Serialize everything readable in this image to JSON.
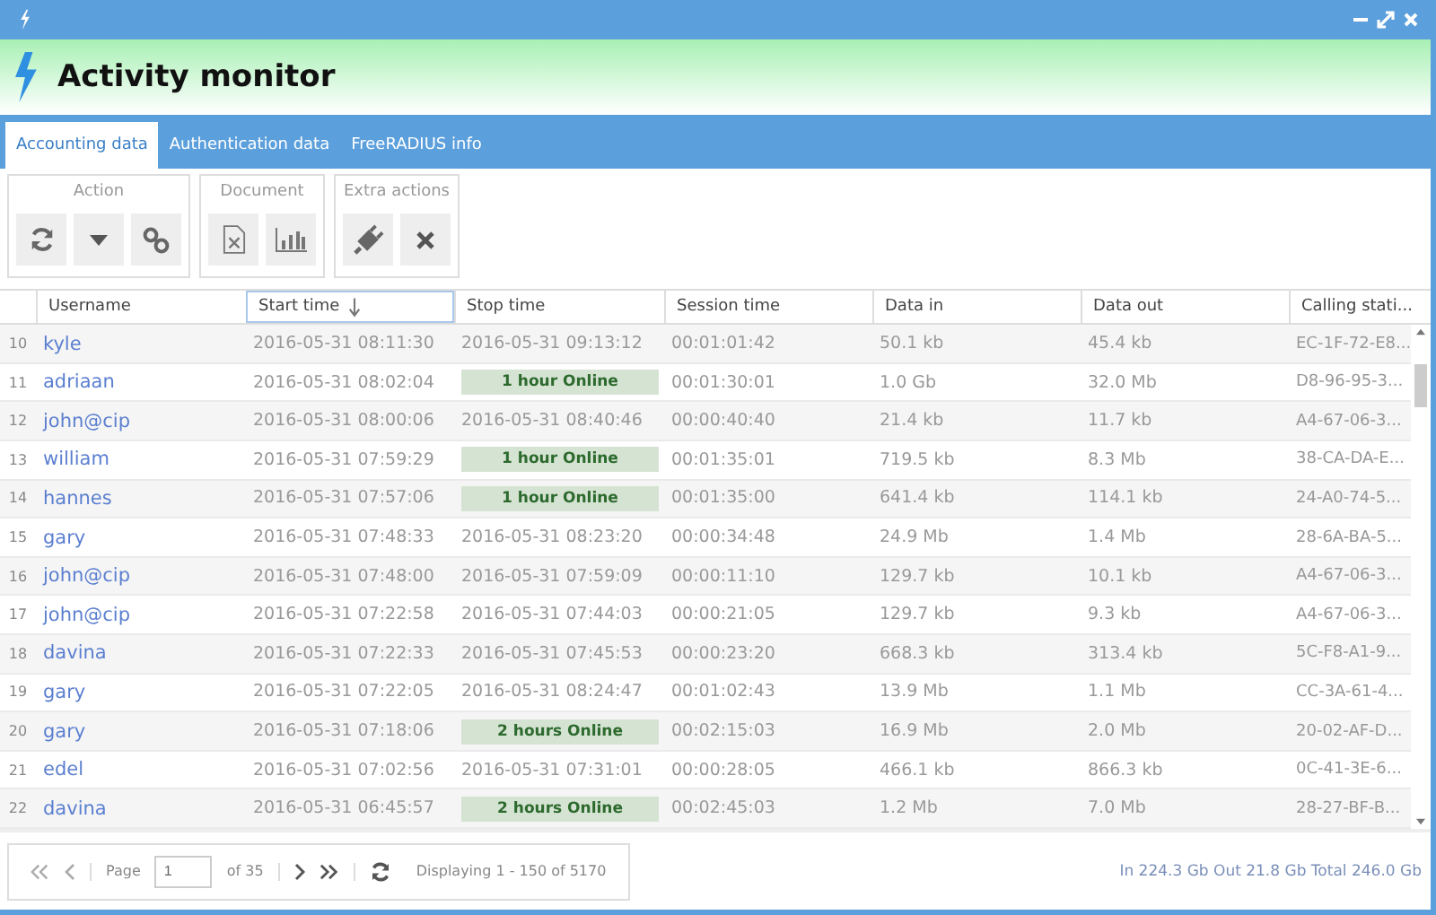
{
  "window": {
    "title": "Activity monitor"
  },
  "tabs": [
    {
      "label": "Accounting data",
      "selected": true
    },
    {
      "label": "Authentication data",
      "selected": false
    },
    {
      "label": "FreeRADIUS info",
      "selected": false
    }
  ],
  "toolbar_groups": [
    {
      "title": "Action",
      "buttons": [
        {
          "kind": "refresh"
        },
        {
          "kind": "dropdown"
        },
        {
          "kind": "link"
        }
      ]
    },
    {
      "title": "Document",
      "buttons": [
        {
          "kind": "excel"
        },
        {
          "kind": "chart"
        }
      ]
    },
    {
      "title": "Extra actions",
      "buttons": [
        {
          "kind": "plug"
        },
        {
          "kind": "delete"
        }
      ]
    }
  ],
  "table": {
    "columns": [
      {
        "label": "Username",
        "sorted": false
      },
      {
        "label": "Start time",
        "sorted": true
      },
      {
        "label": "Stop time",
        "sorted": false
      },
      {
        "label": "Session time",
        "sorted": false
      },
      {
        "label": "Data in",
        "sorted": false
      },
      {
        "label": "Data out",
        "sorted": false
      },
      {
        "label": "Calling stati...",
        "sorted": false
      }
    ],
    "rows": [
      {
        "number": "10",
        "username": "kyle",
        "start": "2016-05-31 08:11:30",
        "stop": {
          "kind": "time",
          "text": "2016-05-31 09:13:12"
        },
        "session": "00:01:01:42",
        "data_in": "50.1 kb",
        "data_out": "45.4 kb",
        "calling": "EC-1F-72-E8..."
      },
      {
        "number": "11",
        "username": "adriaan",
        "start": "2016-05-31 08:02:04",
        "stop": {
          "kind": "online",
          "text": "1 hour Online"
        },
        "session": "00:01:30:01",
        "data_in": "1.0 Gb",
        "data_out": "32.0 Mb",
        "calling": "D8-96-95-3..."
      },
      {
        "number": "12",
        "username": "john@cip",
        "start": "2016-05-31 08:00:06",
        "stop": {
          "kind": "time",
          "text": "2016-05-31 08:40:46"
        },
        "session": "00:00:40:40",
        "data_in": "21.4 kb",
        "data_out": "11.7 kb",
        "calling": "A4-67-06-3..."
      },
      {
        "number": "13",
        "username": "william",
        "start": "2016-05-31 07:59:29",
        "stop": {
          "kind": "online",
          "text": "1 hour Online"
        },
        "session": "00:01:35:01",
        "data_in": "719.5 kb",
        "data_out": "8.3 Mb",
        "calling": "38-CA-DA-E..."
      },
      {
        "number": "14",
        "username": "hannes",
        "start": "2016-05-31 07:57:06",
        "stop": {
          "kind": "online",
          "text": "1 hour Online"
        },
        "session": "00:01:35:00",
        "data_in": "641.4 kb",
        "data_out": "114.1 kb",
        "calling": "24-A0-74-5..."
      },
      {
        "number": "15",
        "username": "gary",
        "start": "2016-05-31 07:48:33",
        "stop": {
          "kind": "time",
          "text": "2016-05-31 08:23:20"
        },
        "session": "00:00:34:48",
        "data_in": "24.9 Mb",
        "data_out": "1.4 Mb",
        "calling": "28-6A-BA-5..."
      },
      {
        "number": "16",
        "username": "john@cip",
        "start": "2016-05-31 07:48:00",
        "stop": {
          "kind": "time",
          "text": "2016-05-31 07:59:09"
        },
        "session": "00:00:11:10",
        "data_in": "129.7 kb",
        "data_out": "10.1 kb",
        "calling": "A4-67-06-3..."
      },
      {
        "number": "17",
        "username": "john@cip",
        "start": "2016-05-31 07:22:58",
        "stop": {
          "kind": "time",
          "text": "2016-05-31 07:44:03"
        },
        "session": "00:00:21:05",
        "data_in": "129.7 kb",
        "data_out": "9.3 kb",
        "calling": "A4-67-06-3..."
      },
      {
        "number": "18",
        "username": "davina",
        "start": "2016-05-31 07:22:33",
        "stop": {
          "kind": "time",
          "text": "2016-05-31 07:45:53"
        },
        "session": "00:00:23:20",
        "data_in": "668.3 kb",
        "data_out": "313.4 kb",
        "calling": "5C-F8-A1-9..."
      },
      {
        "number": "19",
        "username": "gary",
        "start": "2016-05-31 07:22:05",
        "stop": {
          "kind": "time",
          "text": "2016-05-31 08:24:47"
        },
        "session": "00:01:02:43",
        "data_in": "13.9 Mb",
        "data_out": "1.1 Mb",
        "calling": "CC-3A-61-4..."
      },
      {
        "number": "20",
        "username": "gary",
        "start": "2016-05-31 07:18:06",
        "stop": {
          "kind": "online",
          "text": "2 hours Online"
        },
        "session": "00:02:15:03",
        "data_in": "16.9 Mb",
        "data_out": "2.0 Mb",
        "calling": "20-02-AF-D..."
      },
      {
        "number": "21",
        "username": "edel",
        "start": "2016-05-31 07:02:56",
        "stop": {
          "kind": "time",
          "text": "2016-05-31 07:31:01"
        },
        "session": "00:00:28:05",
        "data_in": "466.1 kb",
        "data_out": "866.3 kb",
        "calling": "0C-41-3E-6..."
      },
      {
        "number": "22",
        "username": "davina",
        "start": "2016-05-31 06:45:57",
        "stop": {
          "kind": "online",
          "text": "2 hours Online"
        },
        "session": "00:02:45:03",
        "data_in": "1.2 Mb",
        "data_out": "7.0 Mb",
        "calling": "28-27-BF-B..."
      }
    ]
  },
  "pager": {
    "page_label": "Page",
    "page": "1",
    "of": "of 35",
    "displaying": "Displaying 1 - 150 of 5170"
  },
  "totals": "In 224.3 Gb Out 21.8 Gb Total 246.0 Gb"
}
